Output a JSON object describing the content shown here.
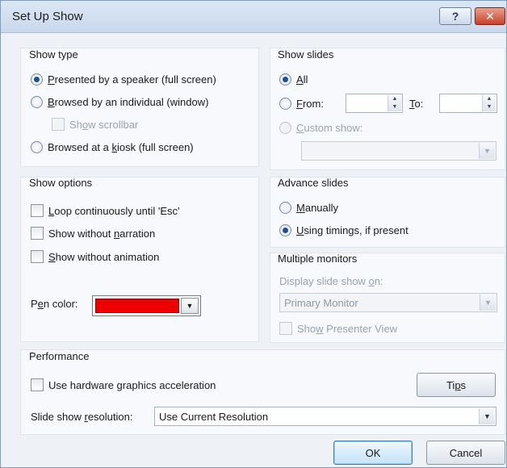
{
  "window": {
    "title": "Set Up Show",
    "help_label": "?",
    "close_label": "✕"
  },
  "show_type": {
    "title": "Show type",
    "presented": {
      "pre": "",
      "key": "P",
      "post": "resented by a speaker (full screen)",
      "selected": true
    },
    "browsed_individual": {
      "pre": "",
      "key": "B",
      "post": "rowsed by an individual (window)",
      "selected": false
    },
    "show_scrollbar": {
      "pre": "Sh",
      "key": "o",
      "post": "w scrollbar",
      "checked": false,
      "disabled": true
    },
    "kiosk": {
      "pre": "Browsed at a ",
      "key": "k",
      "post": "iosk (full screen)",
      "selected": false
    }
  },
  "show_slides": {
    "title": "Show slides",
    "all": {
      "pre": "",
      "key": "A",
      "post": "ll",
      "selected": true
    },
    "from": {
      "pre": "",
      "key": "F",
      "post": "rom:",
      "value": ""
    },
    "to": {
      "pre": "",
      "key": "T",
      "post": "o:",
      "value": ""
    },
    "custom_show": {
      "pre": "",
      "key": "C",
      "post": "ustom show:",
      "value": ""
    }
  },
  "show_options": {
    "title": "Show options",
    "loop": {
      "pre": "",
      "key": "L",
      "post": "oop continuously until 'Esc'",
      "checked": false
    },
    "no_narration": {
      "pre": "Show without ",
      "key": "n",
      "post": "arration",
      "checked": false
    },
    "no_animation": {
      "pre": "",
      "key": "S",
      "post": "how without animation",
      "checked": false
    },
    "pen_color": {
      "pre": "P",
      "key": "e",
      "post": "n color:",
      "value": "#ee0000"
    }
  },
  "advance_slides": {
    "title": "Advance slides",
    "manually": {
      "pre": "",
      "key": "M",
      "post": "anually",
      "selected": false
    },
    "timings": {
      "pre": "",
      "key": "U",
      "post": "sing timings, if present",
      "selected": true
    }
  },
  "multiple_monitors": {
    "title": "Multiple monitors",
    "display_label": {
      "pre": "Display slide show ",
      "key": "o",
      "post": "n:"
    },
    "monitor_value": "Primary Monitor",
    "presenter_view": {
      "pre": "Sho",
      "key": "w",
      "post": " Presenter View",
      "checked": false,
      "disabled": true
    }
  },
  "performance": {
    "title": "Performance",
    "hw_accel": {
      "pre": "Use hardware ",
      "key": "g",
      "post": "raphics acceleration",
      "checked": false
    },
    "tips_label": {
      "pre": "Ti",
      "key": "p",
      "post": "s"
    },
    "resolution_label": {
      "pre": "Slide show ",
      "key": "r",
      "post": "esolution:"
    },
    "resolution_value": "Use Current Resolution"
  },
  "buttons": {
    "ok": "OK",
    "cancel": "Cancel"
  },
  "colors": {
    "accent": "#1f4f8f",
    "pen": "#ee0000",
    "disabled_text": "#9aa3ae"
  }
}
